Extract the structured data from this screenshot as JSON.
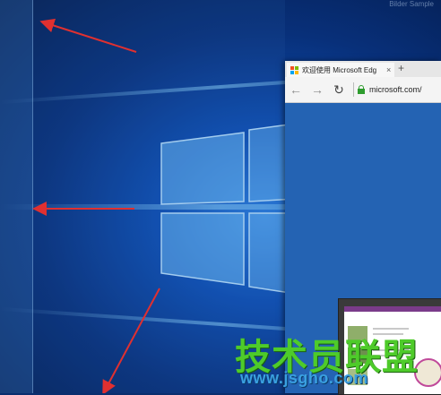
{
  "watermark_top": "Bilder Sample",
  "browser": {
    "tab_title": "欢迎使用 Microsoft Edg",
    "tab_close": "×",
    "new_tab": "+",
    "back_icon": "back-arrow",
    "forward_icon": "forward-arrow",
    "refresh_icon": "refresh",
    "address": "microsoft.com/",
    "logo_colors": [
      "#f25022",
      "#7fba00",
      "#00a4ef",
      "#ffb900"
    ]
  },
  "watermark": {
    "title": "技术员联盟",
    "url": "www.jsgho.com"
  },
  "colors": {
    "arrow": "#e03030",
    "secure": "#2e9c2e"
  }
}
